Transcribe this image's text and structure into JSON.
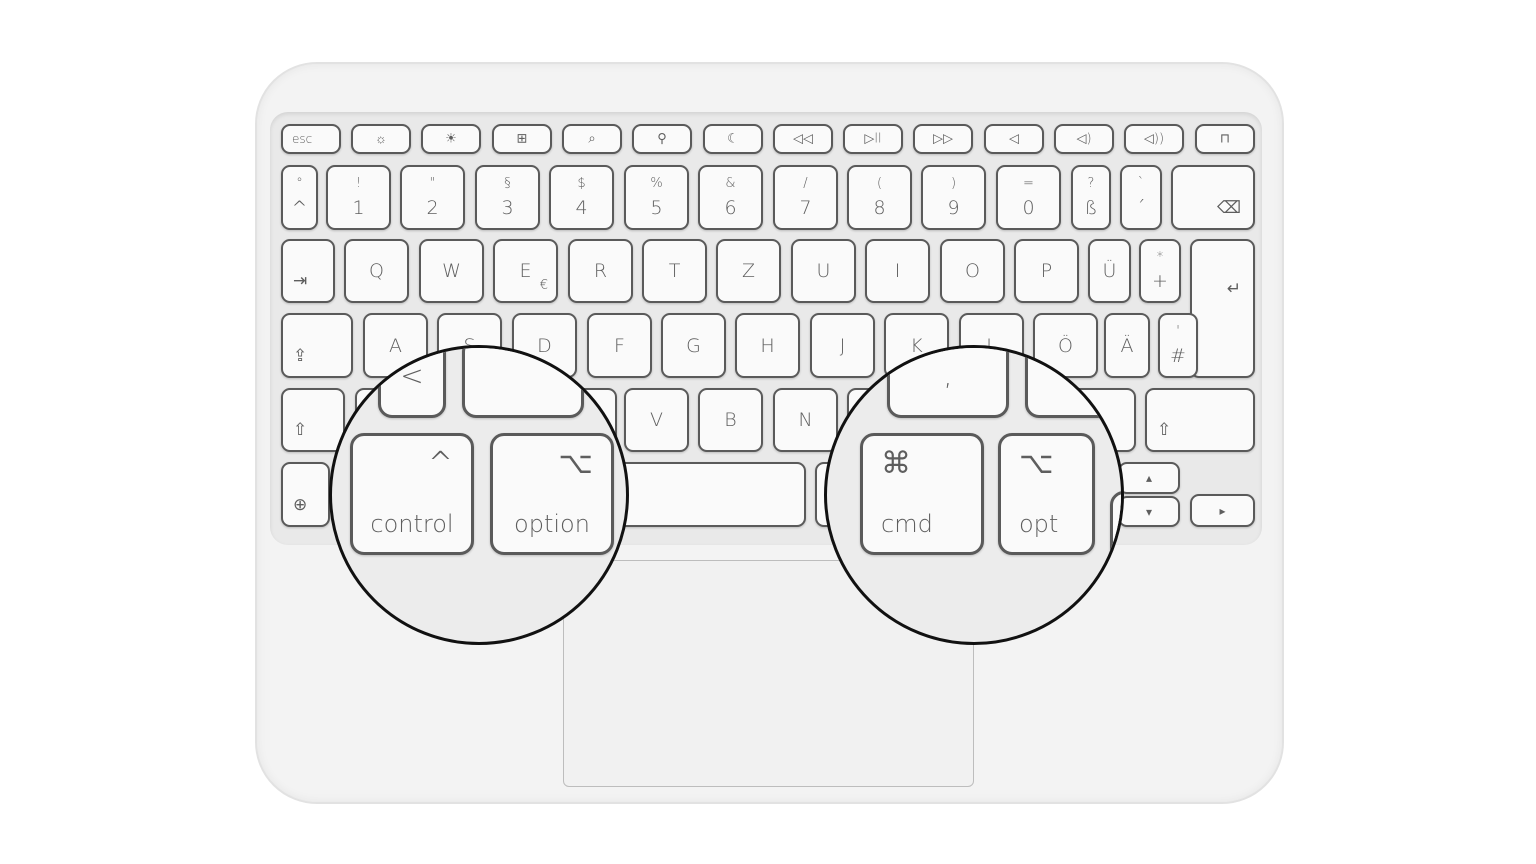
{
  "keyboard": {
    "function_row": [
      {
        "label": "esc"
      },
      {
        "icon": "brightness-down-icon"
      },
      {
        "icon": "brightness-up-icon"
      },
      {
        "icon": "app-switcher-icon"
      },
      {
        "icon": "search-icon"
      },
      {
        "icon": "microphone-icon"
      },
      {
        "icon": "moon-icon"
      },
      {
        "icon": "rewind-icon"
      },
      {
        "icon": "play-pause-icon"
      },
      {
        "icon": "fast-forward-icon"
      },
      {
        "icon": "mute-icon"
      },
      {
        "icon": "volume-down-icon"
      },
      {
        "icon": "volume-up-icon"
      },
      {
        "icon": "lock-icon"
      }
    ],
    "number_row": [
      {
        "top": "°",
        "main": "^"
      },
      {
        "top": "!",
        "main": "1"
      },
      {
        "top": "\"",
        "main": "2"
      },
      {
        "top": "§",
        "main": "3"
      },
      {
        "top": "$",
        "main": "4"
      },
      {
        "top": "%",
        "main": "5"
      },
      {
        "top": "&",
        "main": "6"
      },
      {
        "top": "/",
        "main": "7"
      },
      {
        "top": "(",
        "main": "8"
      },
      {
        "top": ")",
        "main": "9"
      },
      {
        "top": "=",
        "main": "0"
      },
      {
        "top": "?",
        "main": "ß"
      },
      {
        "top": "`",
        "main": "´"
      },
      {
        "icon": "delete-icon"
      }
    ],
    "qwertz_row": [
      {
        "icon": "tab-icon"
      },
      {
        "main": "Q"
      },
      {
        "main": "W"
      },
      {
        "main": "E",
        "sub": "€"
      },
      {
        "main": "R"
      },
      {
        "main": "T"
      },
      {
        "main": "Z"
      },
      {
        "main": "U"
      },
      {
        "main": "I"
      },
      {
        "main": "O"
      },
      {
        "main": "P"
      },
      {
        "main": "Ü"
      },
      {
        "top": "*",
        "main": "+"
      },
      {
        "icon": "return-icon"
      }
    ],
    "home_row": [
      {
        "icon": "caps-lock-icon"
      },
      {
        "main": "A"
      },
      {
        "main": "S"
      },
      {
        "main": "D"
      },
      {
        "main": "F"
      },
      {
        "main": "G"
      },
      {
        "main": "H"
      },
      {
        "main": "J"
      },
      {
        "main": "K"
      },
      {
        "main": "L"
      },
      {
        "main": "Ö"
      },
      {
        "main": "Ä"
      },
      {
        "top": "'",
        "main": "#"
      }
    ],
    "shift_row": [
      {
        "icon": "shift-icon"
      },
      {},
      {},
      {},
      {},
      {
        "main": "V"
      },
      {
        "main": "B"
      },
      {
        "main": "N"
      },
      {},
      {},
      {},
      {},
      {
        "icon": "shift-icon"
      }
    ],
    "bottom_row": [
      {
        "icon": "globe-icon"
      },
      {},
      {},
      {},
      {},
      {},
      {},
      {
        "icon": "arrow-up-icon"
      },
      {
        "icon": "arrow-down-icon"
      },
      {
        "icon": "arrow-right-icon"
      }
    ]
  },
  "magnifier_left": {
    "keys": [
      {
        "main": "<"
      },
      {
        "main": ""
      },
      {
        "symbol": "^",
        "label": "control"
      },
      {
        "symbol": "⌥",
        "label": "option"
      }
    ]
  },
  "magnifier_right": {
    "keys": [
      {
        "main": ","
      },
      {
        "main": ""
      },
      {
        "symbol": "⌘",
        "label": "cmd"
      },
      {
        "symbol": "⌥",
        "label": "opt"
      },
      {
        "main": ""
      }
    ]
  }
}
